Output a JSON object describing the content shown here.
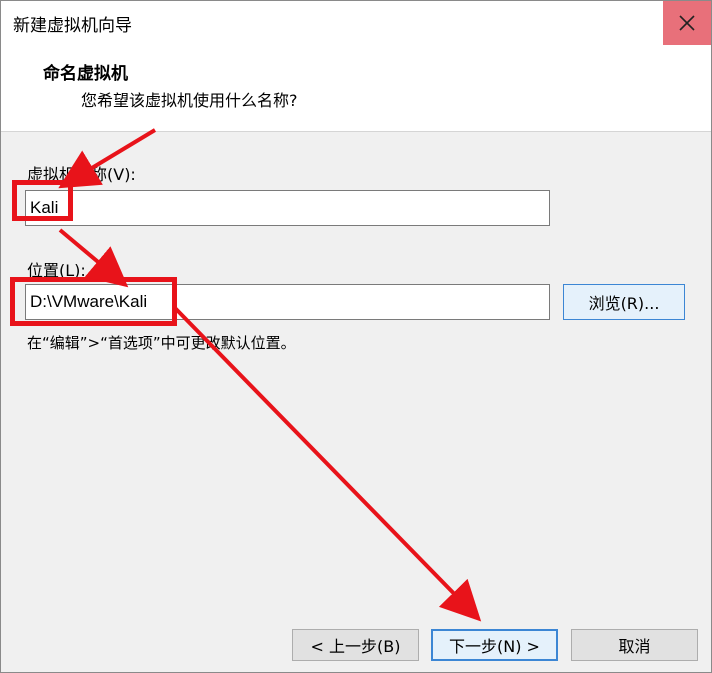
{
  "window": {
    "title": "新建虚拟机向导",
    "close_glyph": "✕"
  },
  "header": {
    "title": "命名虚拟机",
    "subtitle": "您希望该虚拟机使用什么名称?"
  },
  "form": {
    "name_label": "虚拟机名称(V):",
    "name_value": "Kali",
    "location_label": "位置(L):",
    "location_value": "D:\\VMware\\Kali",
    "browse_label": "浏览(R)...",
    "hint": "在“编辑”>“首选项”中可更改默认位置。"
  },
  "footer": {
    "back_label": "< 上一步(B)",
    "next_label": "下一步(N) >",
    "cancel_label": "取消"
  },
  "annotations": {
    "color": "#e8131a"
  }
}
